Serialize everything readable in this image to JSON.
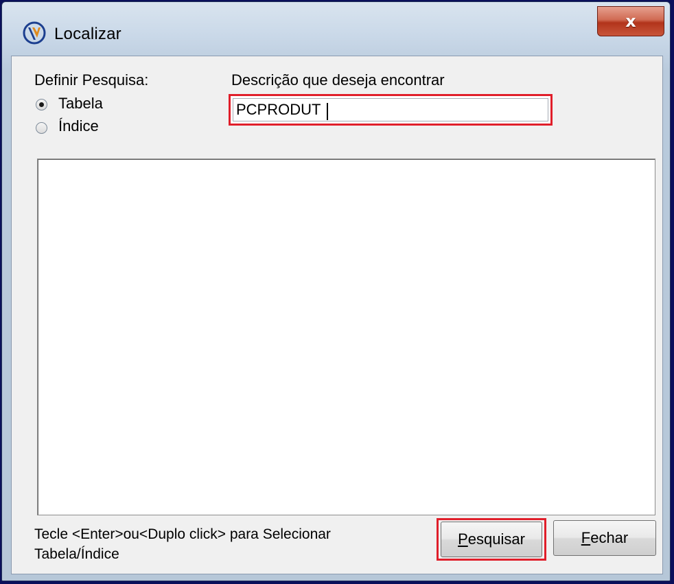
{
  "window": {
    "title": "Localizar",
    "close_label": "x",
    "icon": "app-logo-icon"
  },
  "search_mode": {
    "label": "Definir Pesquisa:",
    "options": [
      {
        "label": "Tabela",
        "checked": true
      },
      {
        "label": "Índice",
        "checked": false
      }
    ]
  },
  "search": {
    "label": "Descrição que deseja encontrar",
    "value": "PCPRODUT"
  },
  "results": [],
  "hint": {
    "line1": "Tecle <Enter>ou<Duplo click> para Selecionar",
    "line2": "Tabela/Índice"
  },
  "buttons": {
    "search_first": "P",
    "search_rest": "esquisar",
    "close_first": "F",
    "close_rest": "echar"
  },
  "colors": {
    "highlight": "#e01e2a",
    "close_button": "#c8553a"
  }
}
